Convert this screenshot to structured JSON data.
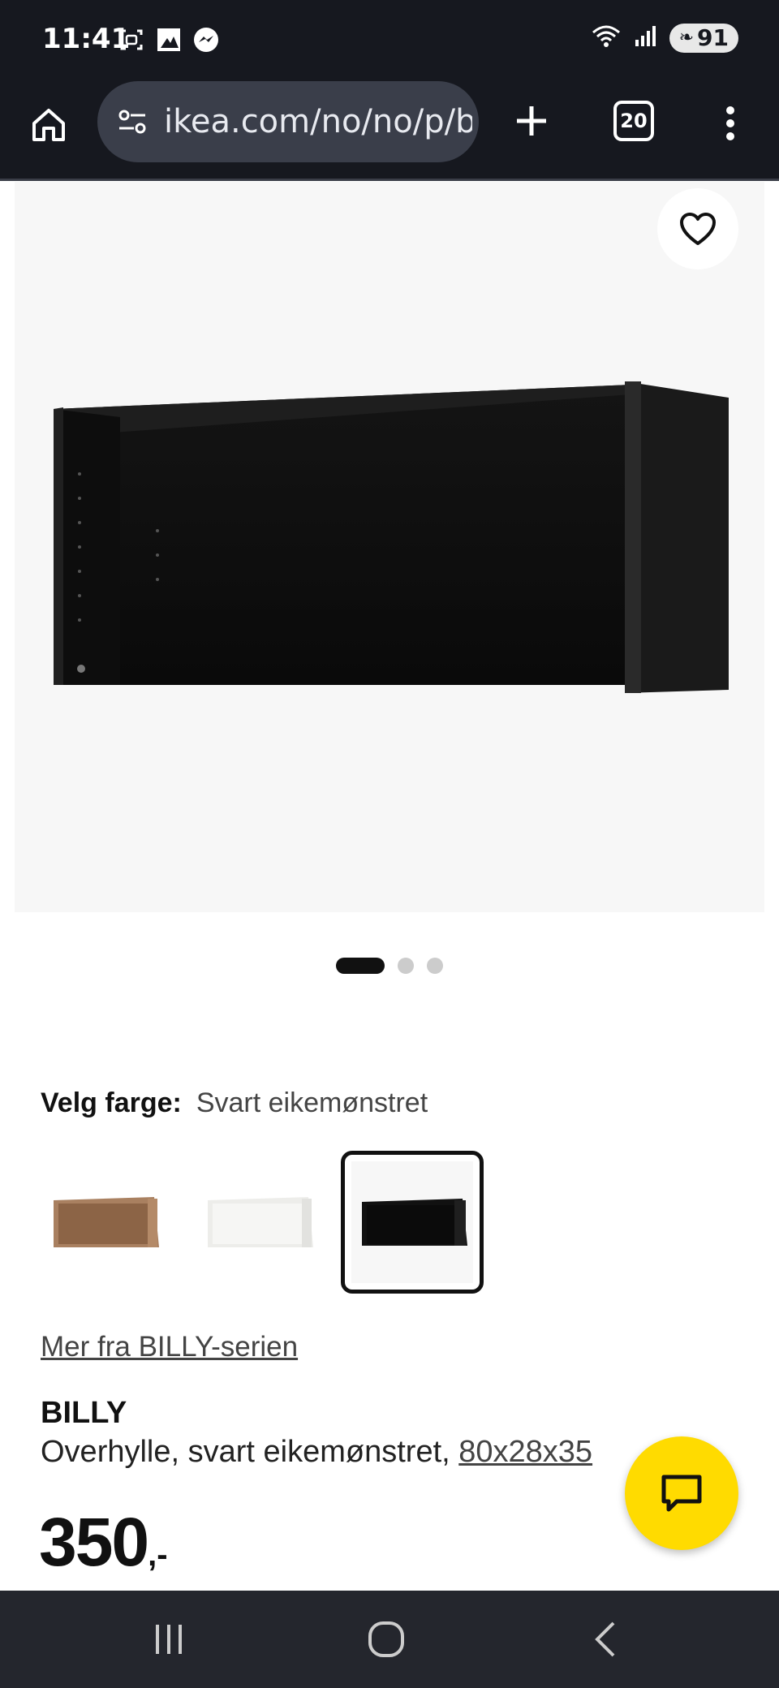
{
  "status_bar": {
    "time": "11:41",
    "battery": "91"
  },
  "browser": {
    "url": "ikea.com/no/no/p/bill",
    "tab_count": "20"
  },
  "gallery": {
    "total_images": 3,
    "active_index": 0
  },
  "color_picker": {
    "label": "Velg farge:",
    "selected_value": "Svart eikemønstret",
    "options": [
      {
        "name": "walnut",
        "color": "#b08a67"
      },
      {
        "name": "white",
        "color": "#f5f5f3"
      },
      {
        "name": "black",
        "color": "#1b1b1b"
      }
    ]
  },
  "series_link": "Mer fra BILLY-serien",
  "product": {
    "brand": "BILLY",
    "description": "Overhylle, svart eikemønstret,",
    "dimensions": "80x28x35",
    "price_int": "350",
    "price_suffix": ",-"
  },
  "colors": {
    "accent_yellow": "#ffdb00",
    "dark_bar": "#16181f"
  }
}
